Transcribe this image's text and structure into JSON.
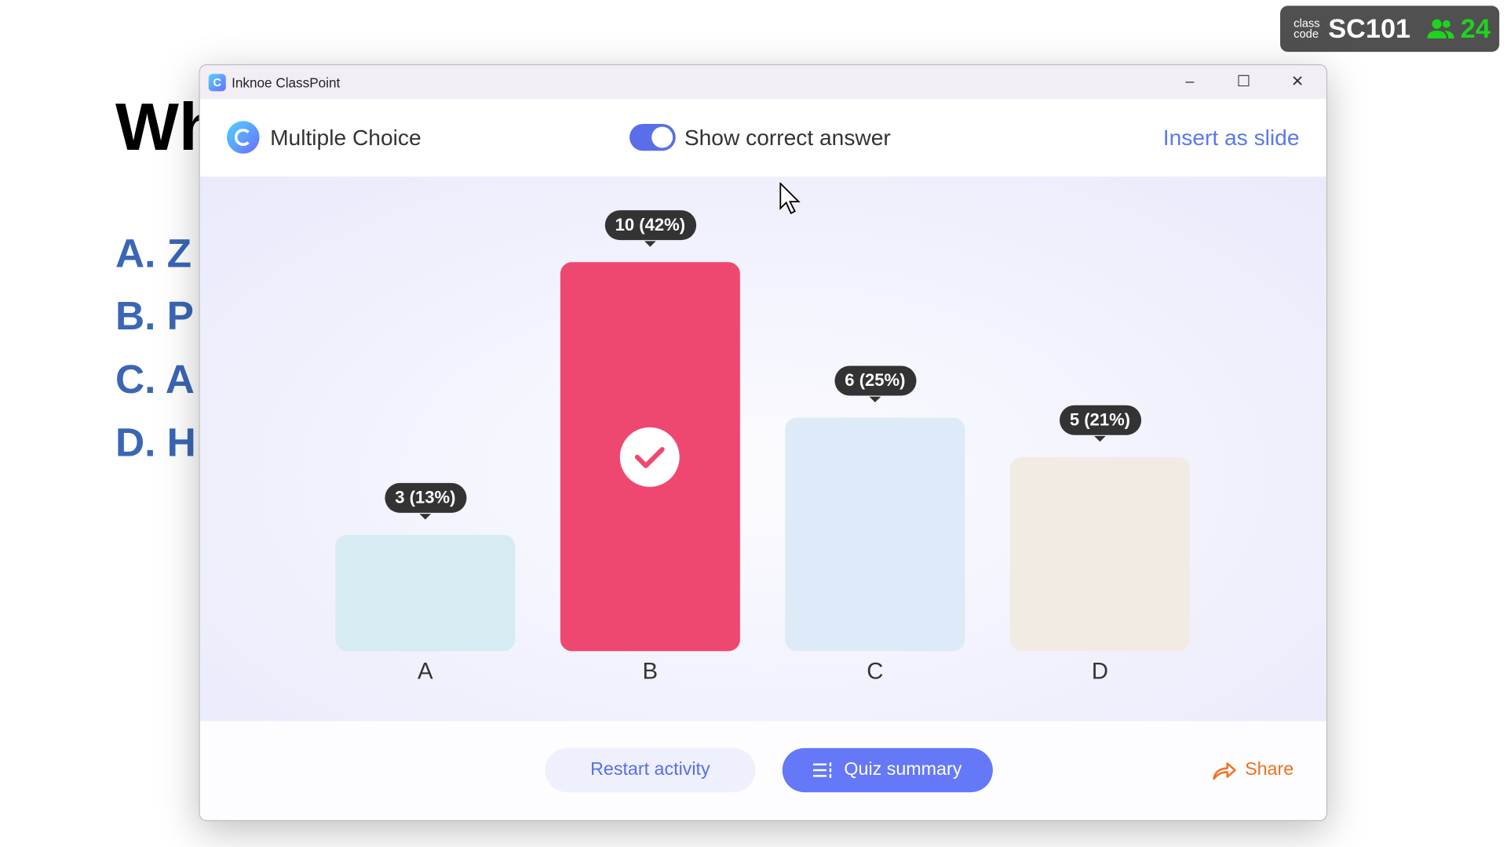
{
  "slide": {
    "title": "Wh",
    "options": [
      "A. Z",
      "B. P",
      "C. A",
      "D. H"
    ]
  },
  "badge": {
    "label_top": "class",
    "label_bottom": "code",
    "code": "SC101",
    "participants": "24",
    "icon": "people-icon"
  },
  "window": {
    "title": "Inknoe ClassPoint",
    "minimize": "–",
    "maximize": "☐",
    "close": "✕"
  },
  "header": {
    "title": "Multiple Choice",
    "toggle_label": "Show correct answer",
    "toggle_on": true,
    "insert": "Insert as slide"
  },
  "chart_data": {
    "type": "bar",
    "categories": [
      "A",
      "B",
      "C",
      "D"
    ],
    "values": [
      3,
      10,
      6,
      5
    ],
    "labels": [
      "3 (13%)",
      "10 (42%)",
      "6 (25%)",
      "5 (21%)"
    ],
    "correct": "B",
    "colors": [
      "#d6ecf2",
      "#ef4870",
      "#deeaf8",
      "#f1ebe4"
    ],
    "ylim": [
      0,
      10
    ]
  },
  "footer": {
    "restart": "Restart activity",
    "quiz": "Quiz summary",
    "share": "Share"
  }
}
